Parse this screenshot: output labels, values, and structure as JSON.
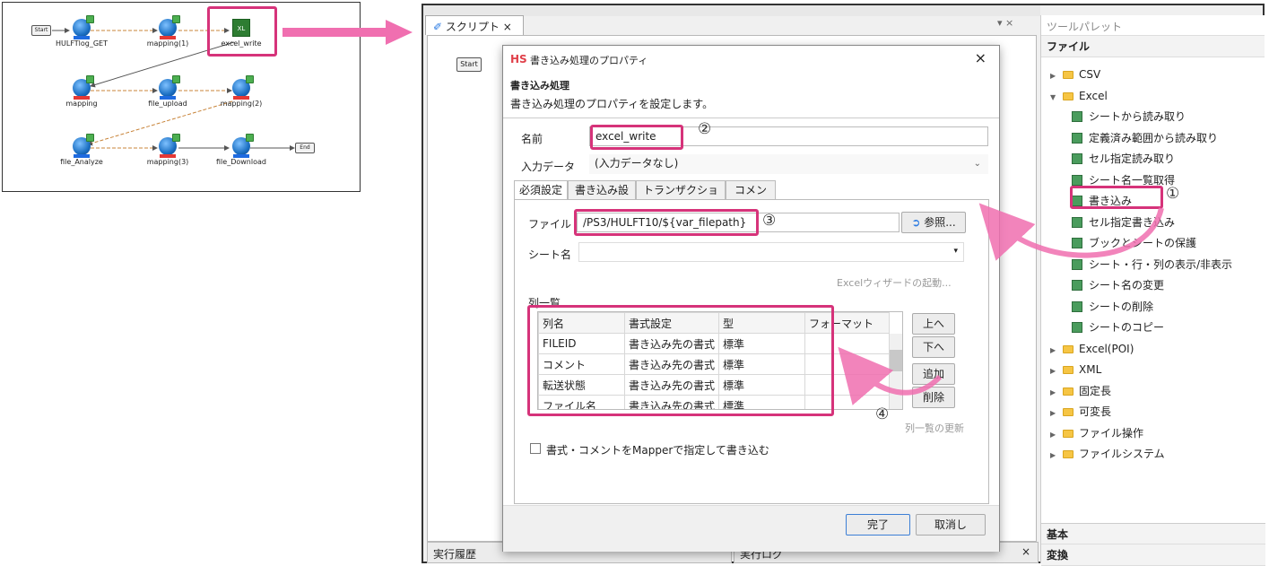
{
  "flow": {
    "nodes": [
      {
        "label": "HULFTlog_GET"
      },
      {
        "label": "mapping(1)"
      },
      {
        "label": "excel_write"
      },
      {
        "label": "mapping"
      },
      {
        "label": "file_upload"
      },
      {
        "label": "mapping(2)"
      },
      {
        "label": "file_Analyze"
      },
      {
        "label": "mapping(3)"
      },
      {
        "label": "file_Download"
      }
    ],
    "start_label": "Start",
    "end_label": "End"
  },
  "editor": {
    "tab_label": "スクリプト",
    "start_label": "Start",
    "history_label": "実行履歴",
    "log_label": "実行ログ"
  },
  "dialog": {
    "title": "書き込み処理のプロパティ",
    "logo": "HS",
    "heading": "書き込み処理",
    "description": "書き込み処理のプロパティを設定します。",
    "name_label": "名前",
    "name_value": "excel_write",
    "input_label": "入力データ",
    "input_value": "(入力データなし)",
    "tabs": [
      "必須設定",
      "書き込み設定",
      "トランザクション",
      "コメント"
    ],
    "file_label": "ファイル",
    "file_value": "/PS3/HULFT10/${var_filepath}",
    "browse_label": "参照...",
    "sheet_label": "シート名",
    "wizard_label": "Excelウィザードの起動...",
    "columns_label": "列一覧",
    "columns_headers": [
      "列名",
      "書式設定",
      "型",
      "フォーマット"
    ],
    "columns_rows": [
      [
        "FILEID",
        "書き込み先の書式",
        "標準",
        ""
      ],
      [
        "コメント",
        "書き込み先の書式",
        "標準",
        ""
      ],
      [
        "転送状態",
        "書き込み先の書式",
        "標準",
        ""
      ],
      [
        "ファイル名",
        "書き込み先の書式",
        "標準",
        ""
      ]
    ],
    "up_label": "上へ",
    "down_label": "下へ",
    "add_label": "追加",
    "delete_label": "削除",
    "refresh_label": "列一覧の更新",
    "mapper_checkbox_label": "書式・コメントをMapperで指定して書き込む",
    "ok_label": "完了",
    "cancel_label": "取消し"
  },
  "palette": {
    "title": "ツールパレット",
    "section": "ファイル",
    "items": [
      {
        "label": "CSV",
        "level": 0,
        "expanded": false
      },
      {
        "label": "Excel",
        "level": 0,
        "expanded": true
      },
      {
        "label": "シートから読み取り",
        "level": 1
      },
      {
        "label": "定義済み範囲から読み取り",
        "level": 1
      },
      {
        "label": "セル指定読み取り",
        "level": 1
      },
      {
        "label": "シート名一覧取得",
        "level": 1
      },
      {
        "label": "書き込み",
        "level": 1
      },
      {
        "label": "セル指定書き込み",
        "level": 1
      },
      {
        "label": "ブックとシートの保護",
        "level": 1
      },
      {
        "label": "シート・行・列の表示/非表示",
        "level": 1
      },
      {
        "label": "シート名の変更",
        "level": 1
      },
      {
        "label": "シートの削除",
        "level": 1
      },
      {
        "label": "シートのコピー",
        "level": 1
      },
      {
        "label": "Excel(POI)",
        "level": 0,
        "expanded": false
      },
      {
        "label": "XML",
        "level": 0,
        "expanded": false
      },
      {
        "label": "固定長",
        "level": 0,
        "expanded": false
      },
      {
        "label": "可変長",
        "level": 0,
        "expanded": false
      },
      {
        "label": "ファイル操作",
        "level": 0,
        "expanded": false
      },
      {
        "label": "ファイルシステム",
        "level": 0,
        "expanded": false
      }
    ],
    "bottom_sections": [
      "基本",
      "変換"
    ]
  },
  "markers": [
    "①",
    "②",
    "③",
    "④"
  ],
  "colors": {
    "highlight": "#d6337a",
    "arrow": "#f06fb0"
  }
}
